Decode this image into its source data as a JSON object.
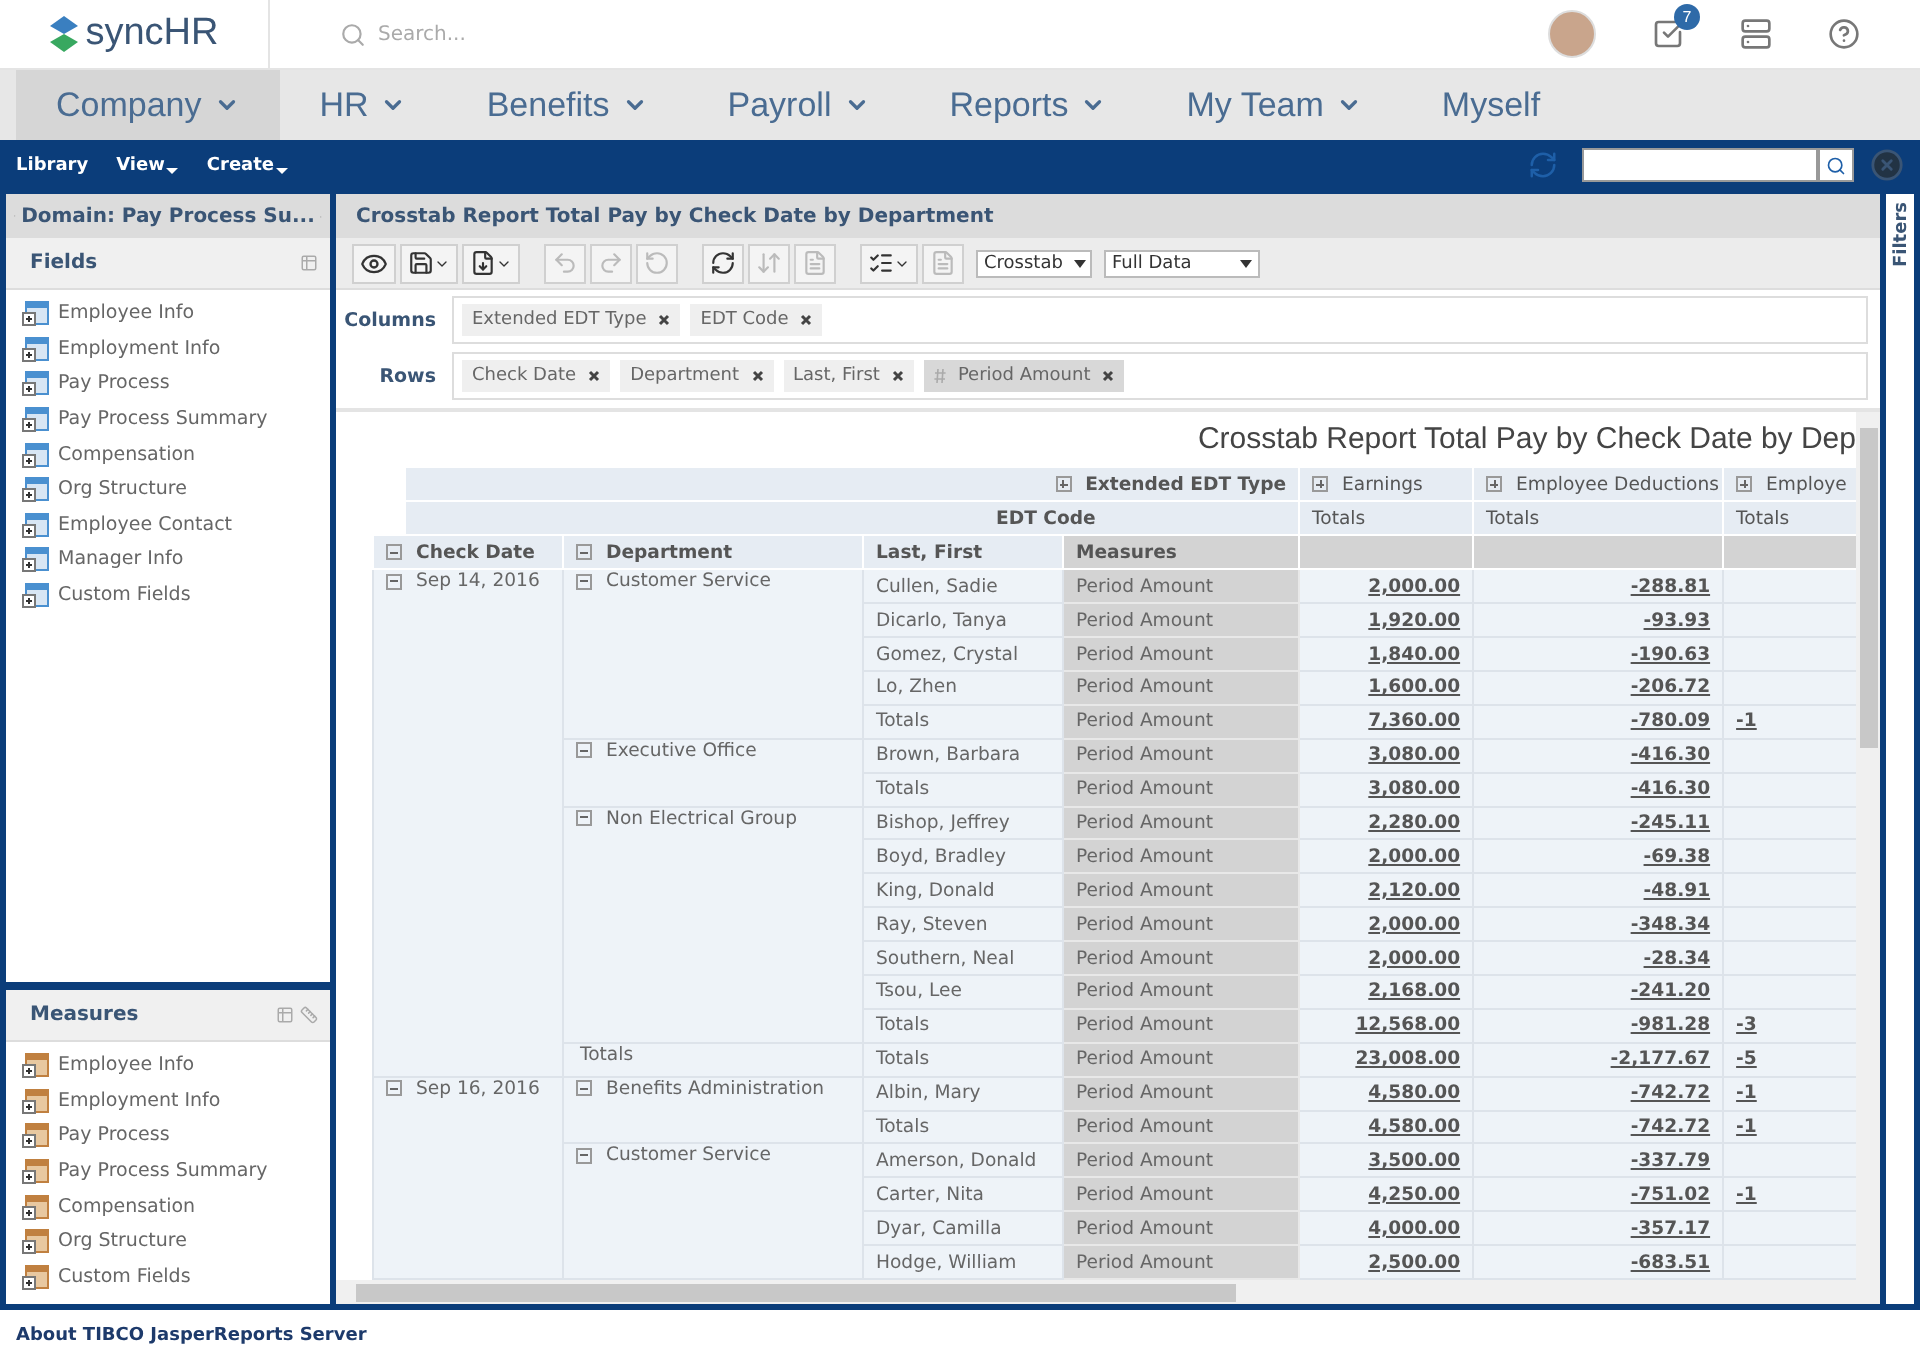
{
  "header": {
    "logo": "syncHR",
    "search": {
      "placeholder": "Search..."
    },
    "notifications_badge": "7"
  },
  "nav": [
    {
      "label": "Company",
      "selected": true,
      "dropdown": true
    },
    {
      "label": "HR",
      "selected": false,
      "dropdown": true
    },
    {
      "label": "Benefits",
      "selected": false,
      "dropdown": true
    },
    {
      "label": "Payroll",
      "selected": false,
      "dropdown": true
    },
    {
      "label": "Reports",
      "selected": false,
      "dropdown": true
    },
    {
      "label": "My Team",
      "selected": false,
      "dropdown": true
    },
    {
      "label": "Myself",
      "selected": false,
      "dropdown": false
    }
  ],
  "toolbar_menus": [
    {
      "label": "Library",
      "dropdown": false
    },
    {
      "label": "View",
      "dropdown": true
    },
    {
      "label": "Create",
      "dropdown": true
    }
  ],
  "sidebar": {
    "domain_title": "Domain: Pay Process Su...",
    "fields_title": "Fields",
    "fields": [
      "Employee Info",
      "Employment Info",
      "Pay Process",
      "Pay Process Summary",
      "Compensation",
      "Org Structure",
      "Employee Contact",
      "Manager Info",
      "Custom Fields"
    ],
    "measures_title": "Measures",
    "measures": [
      "Employee Info",
      "Employment Info",
      "Pay Process",
      "Pay Process Summary",
      "Compensation",
      "Org Structure",
      "Custom Fields"
    ]
  },
  "report": {
    "title": "Crosstab Report Total Pay by Check Date by Department",
    "view_select": "Crosstab",
    "data_select": "Full Data",
    "columns_label": "Columns",
    "columns": [
      {
        "label": "Extended EDT Type",
        "kind": "dimension"
      },
      {
        "label": "EDT Code",
        "kind": "dimension"
      }
    ],
    "rows_label": "Rows",
    "rows": [
      {
        "label": "Check Date",
        "kind": "dimension"
      },
      {
        "label": "Department",
        "kind": "dimension"
      },
      {
        "label": "Last, First",
        "kind": "dimension"
      },
      {
        "label": "Period Amount",
        "kind": "measure"
      }
    ],
    "filters_label": "Filters"
  },
  "crosstab": {
    "title": "Crosstab Report Total Pay by Check Date by Dep",
    "column_header_rows": [
      {
        "label": "Extended EDT Type",
        "expanded": false,
        "cells": [
          {
            "label": "Earnings",
            "expanded": false
          },
          {
            "label": "Employee Deductions",
            "expanded": false
          },
          {
            "label": "Employe",
            "expanded": false
          }
        ]
      },
      {
        "label": "EDT Code",
        "cells": [
          {
            "label": "Totals"
          },
          {
            "label": "Totals"
          },
          {
            "label": "Totals"
          }
        ]
      }
    ],
    "row_headers": [
      {
        "label": "Check Date",
        "expanded": true
      },
      {
        "label": "Department",
        "expanded": true
      },
      {
        "label": "Last, First"
      },
      {
        "label": "Measures"
      }
    ],
    "groups": [
      {
        "check_date": "Sep 14, 2016",
        "expanded": true,
        "departments": [
          {
            "name": "Customer Service",
            "kind": "group",
            "expanded": true,
            "rows": [
              {
                "name": "Cullen, Sadie",
                "measure": "Period Amount",
                "earnings": "2,000.00",
                "deductions": "-288.81"
              },
              {
                "name": "Dicarlo, Tanya",
                "measure": "Period Amount",
                "earnings": "1,920.00",
                "deductions": "-93.93"
              },
              {
                "name": "Gomez, Crystal",
                "measure": "Period Amount",
                "earnings": "1,840.00",
                "deductions": "-190.63"
              },
              {
                "name": "Lo, Zhen",
                "measure": "Period Amount",
                "earnings": "1,600.00",
                "deductions": "-206.72"
              },
              {
                "name": "Totals",
                "measure": "Period Amount",
                "earnings": "7,360.00",
                "deductions": "-780.09",
                "column_3": "-1"
              }
            ]
          },
          {
            "name": "Executive Office",
            "kind": "group",
            "expanded": true,
            "rows": [
              {
                "name": "Brown, Barbara",
                "measure": "Period Amount",
                "earnings": "3,080.00",
                "deductions": "-416.30"
              },
              {
                "name": "Totals",
                "measure": "Period Amount",
                "earnings": "3,080.00",
                "deductions": "-416.30"
              }
            ]
          },
          {
            "name": "Non Electrical Group",
            "kind": "group",
            "expanded": true,
            "rows": [
              {
                "name": "Bishop, Jeffrey",
                "measure": "Period Amount",
                "earnings": "2,280.00",
                "deductions": "-245.11"
              },
              {
                "name": "Boyd, Bradley",
                "measure": "Period Amount",
                "earnings": "2,000.00",
                "deductions": "-69.38"
              },
              {
                "name": "King, Donald",
                "measure": "Period Amount",
                "earnings": "2,120.00",
                "deductions": "-48.91"
              },
              {
                "name": "Ray, Steven",
                "measure": "Period Amount",
                "earnings": "2,000.00",
                "deductions": "-348.34"
              },
              {
                "name": "Southern, Neal",
                "measure": "Period Amount",
                "earnings": "2,000.00",
                "deductions": "-28.34"
              },
              {
                "name": "Tsou, Lee",
                "measure": "Period Amount",
                "earnings": "2,168.00",
                "deductions": "-241.20"
              },
              {
                "name": "Totals",
                "measure": "Period Amount",
                "earnings": "12,568.00",
                "deductions": "-981.28",
                "column_3": "-3"
              }
            ]
          },
          {
            "name": "Totals",
            "kind": "total",
            "rows": [
              {
                "name": "Totals",
                "measure": "Period Amount",
                "earnings": "23,008.00",
                "deductions": "-2,177.67",
                "column_3": "-5"
              }
            ]
          }
        ]
      },
      {
        "check_date": "Sep 16, 2016",
        "expanded": true,
        "departments": [
          {
            "name": "Benefits Administration",
            "kind": "group",
            "expanded": true,
            "rows": [
              {
                "name": "Albin, Mary",
                "measure": "Period Amount",
                "earnings": "4,580.00",
                "deductions": "-742.72",
                "column_3": "-1"
              },
              {
                "name": "Totals",
                "measure": "Period Amount",
                "earnings": "4,580.00",
                "deductions": "-742.72",
                "column_3": "-1"
              }
            ]
          },
          {
            "name": "Customer Service",
            "kind": "group",
            "expanded": true,
            "rows": [
              {
                "name": "Amerson, Donald",
                "measure": "Period Amount",
                "earnings": "3,500.00",
                "deductions": "-337.79"
              },
              {
                "name": "Carter, Nita",
                "measure": "Period Amount",
                "earnings": "4,250.00",
                "deductions": "-751.02",
                "column_3": "-1"
              },
              {
                "name": "Dyar, Camilla",
                "measure": "Period Amount",
                "earnings": "4,000.00",
                "deductions": "-357.17"
              },
              {
                "name": "Hodge, William",
                "measure": "Period Amount",
                "earnings": "2,500.00",
                "deductions": "-683.51"
              }
            ]
          }
        ]
      }
    ]
  },
  "footer": {
    "link": "About TIBCO JasperReports Server"
  }
}
